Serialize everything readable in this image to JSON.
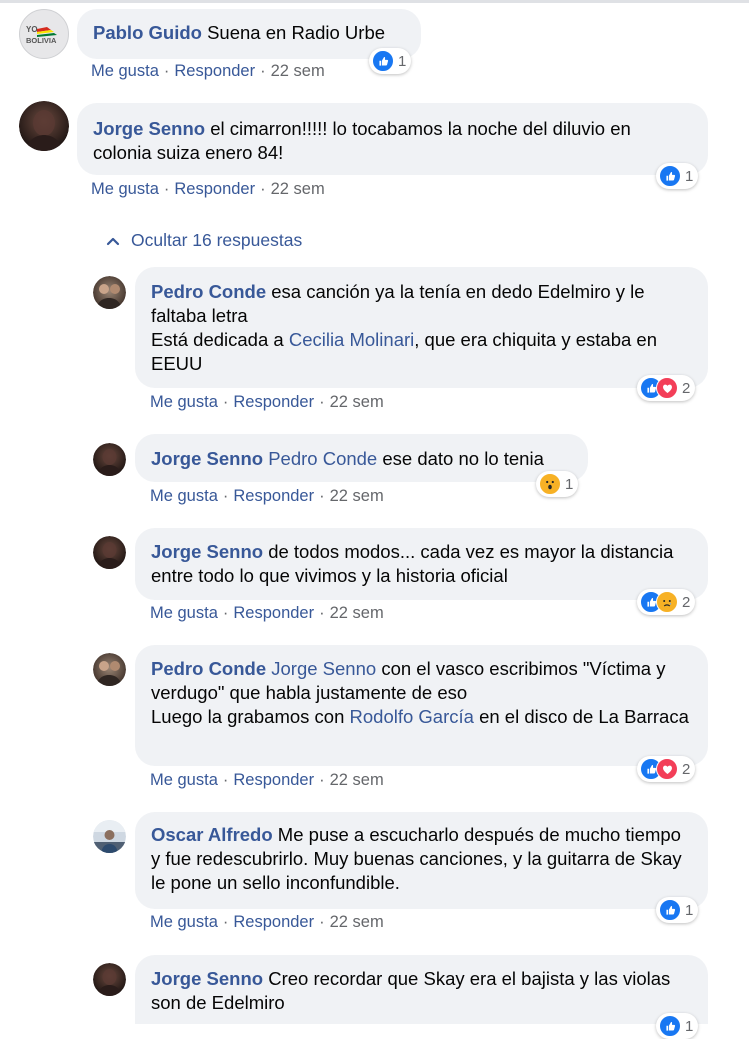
{
  "reactions_colors": {
    "like": "#1877f2",
    "love": "#f33e58",
    "wow": "#f7b125",
    "sad": "#f7b125"
  },
  "comments": [
    {
      "author": "Pablo Guido",
      "text": " Suena en Radio Urbe",
      "avatar_icon": "yo-soy-bolivia-logo",
      "avatar_text_top": "YO",
      "avatar_text_bottom": "BOLIVIA",
      "like": "Me gusta",
      "reply": "Responder",
      "time": "22 sem",
      "reactions": [
        "like"
      ],
      "reaction_count": "1"
    },
    {
      "author": "Jorge Senno",
      "text": " el cimarron!!!!! lo tocabamos la noche del diluvio en colonia suiza enero 84!",
      "like": "Me gusta",
      "reply": "Responder",
      "time": "22 sem",
      "reactions": [
        "like"
      ],
      "reaction_count": "1"
    }
  ],
  "replies_toggle": "Ocultar 16 respuestas",
  "replies": [
    {
      "author": "Pedro Conde",
      "text_a": " esa canción ya la tenía en dedo Edelmiro y le faltaba letra",
      "text_b": "Está dedicada a ",
      "mention": "Cecilia Molinari",
      "text_c": ", que era chiquita y estaba en EEUU",
      "like": "Me gusta",
      "reply": "Responder",
      "time": "22 sem",
      "reactions": [
        "like",
        "love"
      ],
      "reaction_count": "2"
    },
    {
      "author": "Jorge Senno",
      "mention": "Pedro Conde",
      "text": " ese dato no lo tenia",
      "like": "Me gusta",
      "reply": "Responder",
      "time": "22 sem",
      "reactions": [
        "wow"
      ],
      "reaction_count": "1"
    },
    {
      "author": "Jorge Senno",
      "text": " de todos modos... cada vez es mayor la distancia entre todo lo que vivimos y la historia oficial",
      "like": "Me gusta",
      "reply": "Responder",
      "time": "22 sem",
      "reactions": [
        "like",
        "sad"
      ],
      "reaction_count": "2"
    },
    {
      "author": "Pedro Conde",
      "mention": "Jorge Senno",
      "text_a": " con el vasco escribimos \"Víctima y verdugo\" que habla justamente de eso",
      "text_b": "Luego la grabamos con ",
      "mention2": "Rodolfo García",
      "text_c": " en el disco de La Barraca",
      "like": "Me gusta",
      "reply": "Responder",
      "time": "22 sem",
      "reactions": [
        "like",
        "love"
      ],
      "reaction_count": "2"
    },
    {
      "author": "Oscar Alfredo",
      "text": " Me puse a escucharlo después de mucho tiempo y fue redescubrirlo. Muy buenas canciones, y la guitarra de Skay le pone un sello inconfundible.",
      "like": "Me gusta",
      "reply": "Responder",
      "time": "22 sem",
      "reactions": [
        "like"
      ],
      "reaction_count": "1"
    },
    {
      "author": "Jorge Senno",
      "text": " Creo recordar que Skay era el bajista y las violas son de Edelmiro",
      "reactions": [
        "like"
      ],
      "reaction_count": "1"
    }
  ]
}
